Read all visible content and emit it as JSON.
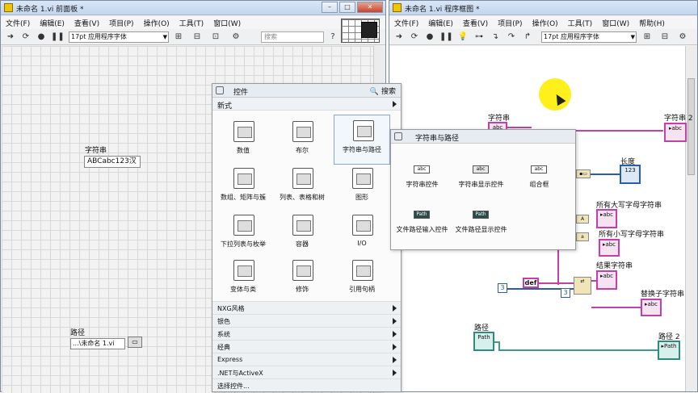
{
  "front_panel": {
    "title": "未命名 1.vi 前面板 *",
    "menu": [
      "文件(F)",
      "编辑(E)",
      "查看(V)",
      "项目(P)",
      "操作(O)",
      "工具(T)",
      "窗口(W)"
    ],
    "font": "17pt 应用程序字体",
    "search_placeholder": "搜索",
    "string_label": "字符串",
    "string_value": "ABCabc123汉",
    "path_label": "路径",
    "path_value": "...\\未命名 1.vi"
  },
  "block_diagram": {
    "title": "未命名 1.vi 程序框图 *",
    "menu": [
      "文件(F)",
      "编辑(E)",
      "查看(V)",
      "项目(P)",
      "操作(O)",
      "工具(T)",
      "窗口(W)",
      "帮助(H)"
    ],
    "font": "17pt 应用程序字体",
    "labels": {
      "string": "字符串",
      "string2": "字符串 2",
      "length": "长度",
      "uppercase": "所有大写字母字符串",
      "lowercase": "所有小写字母字符串",
      "result": "结果字符串",
      "substring": "替换子字符串",
      "path": "路径",
      "path2": "路径 2"
    },
    "constants": {
      "c1": "3",
      "c2": "3",
      "def": "def"
    },
    "terminal_text": {
      "string": "abc",
      "length": "123",
      "path": "Path"
    }
  },
  "palette": {
    "title": "控件",
    "search": "搜索",
    "new": "新式",
    "items": [
      {
        "label": "数值"
      },
      {
        "label": "布尔"
      },
      {
        "label": "字符串与路径"
      },
      {
        "label": "数组、矩阵与簇"
      },
      {
        "label": "列表、表格和树"
      },
      {
        "label": "图形"
      },
      {
        "label": "下拉列表与枚举"
      },
      {
        "label": "容器"
      },
      {
        "label": "I/O"
      },
      {
        "label": "变体与类"
      },
      {
        "label": "修饰"
      },
      {
        "label": "引用句柄"
      }
    ],
    "categories": [
      "NXG风格",
      "银色",
      "系统",
      "经典",
      "Express",
      ".NET与ActiveX",
      "选择控件..."
    ]
  },
  "subpalette": {
    "title": "字符串与路径",
    "items": [
      {
        "label": "字符串控件",
        "icon": "abc"
      },
      {
        "label": "字符串显示控件",
        "icon": "abc"
      },
      {
        "label": "组合框",
        "icon": "abc"
      },
      {
        "label": "文件路径输入控件",
        "icon": "Path"
      },
      {
        "label": "文件路径显示控件",
        "icon": "Path"
      }
    ]
  }
}
